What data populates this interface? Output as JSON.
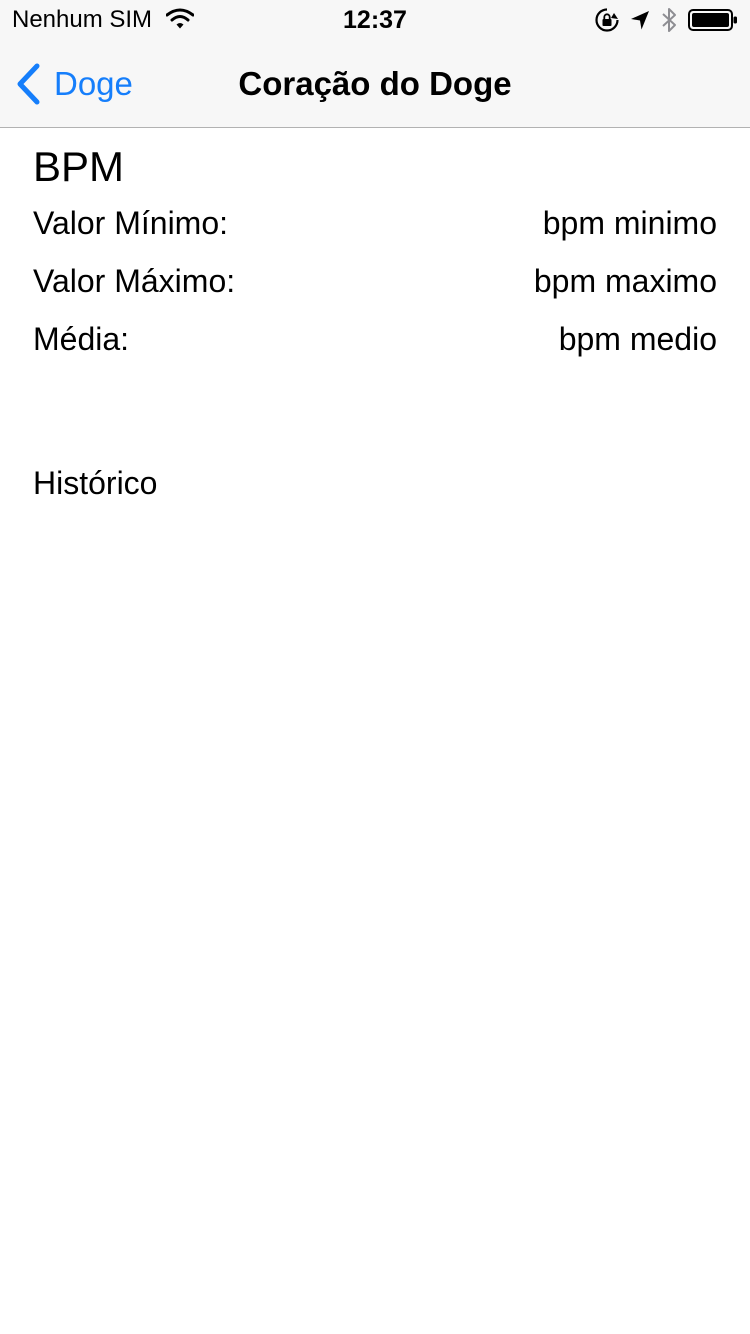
{
  "status_bar": {
    "carrier": "Nenhum SIM",
    "time": "12:37",
    "icons": [
      "wifi-icon",
      "orientation-lock-icon",
      "location-arrow-icon",
      "bluetooth-icon",
      "battery-icon"
    ]
  },
  "nav": {
    "back_label": "Doge",
    "title": "Coração do Doge",
    "accent_color": "#157efb"
  },
  "bpm": {
    "title": "BPM",
    "rows": [
      {
        "label": "Valor Mínimo:",
        "value": "bpm minimo"
      },
      {
        "label": "Valor Máximo:",
        "value": "bpm maximo"
      },
      {
        "label": "Média:",
        "value": "bpm medio"
      }
    ]
  },
  "history": {
    "title": "Histórico"
  }
}
